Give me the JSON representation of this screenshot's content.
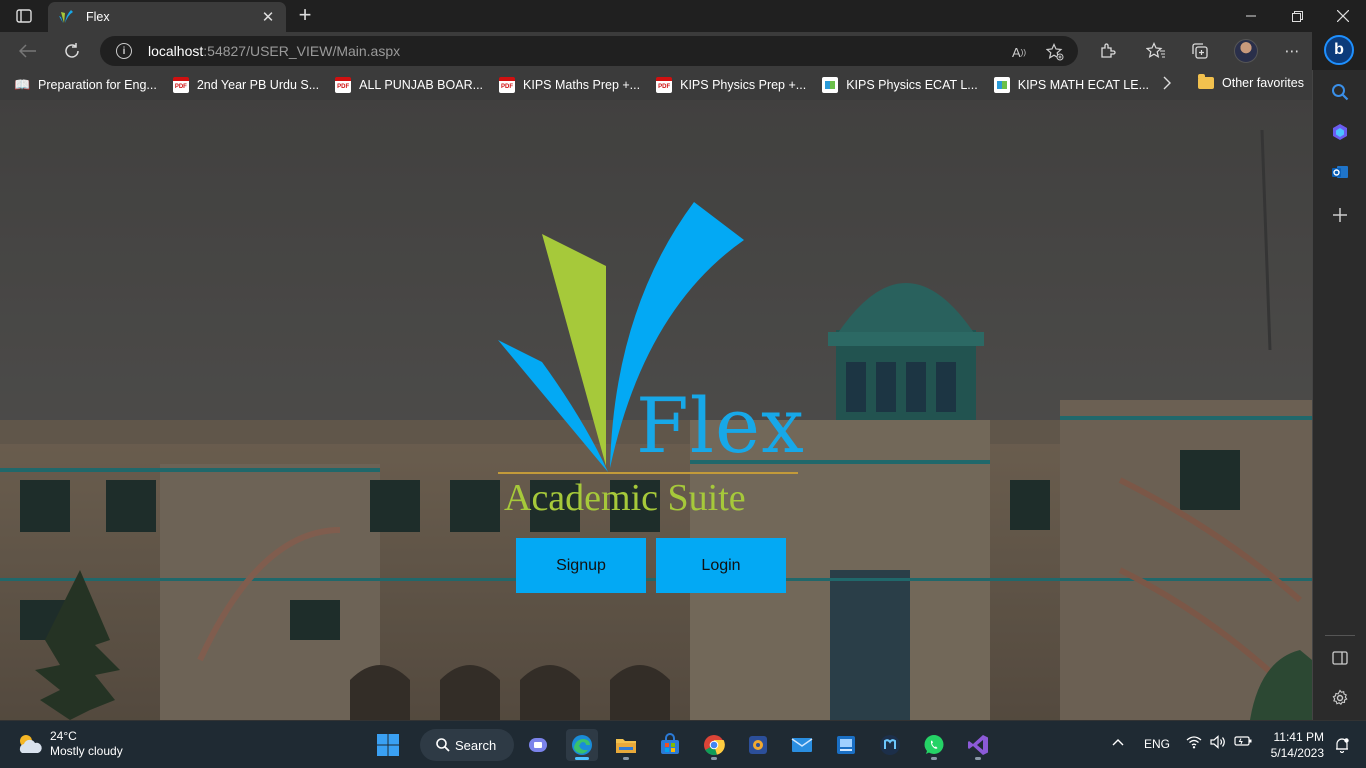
{
  "browser": {
    "tab_title": "Flex",
    "url_host": "localhost",
    "url_rest": ":54827/USER_VIEW/Main.aspx"
  },
  "favorites": {
    "items": [
      {
        "label": "Preparation for Eng...",
        "icon": "book-icon"
      },
      {
        "label": "2nd Year PB Urdu S...",
        "icon": "pdf-icon"
      },
      {
        "label": "ALL PUNJAB BOAR...",
        "icon": "pdf-icon"
      },
      {
        "label": "KIPS Maths Prep +...",
        "icon": "pdf-icon"
      },
      {
        "label": "KIPS Physics Prep +...",
        "icon": "pdf-icon"
      },
      {
        "label": "KIPS Physics ECAT L...",
        "icon": "kips-icon"
      },
      {
        "label": "KIPS MATH ECAT LE...",
        "icon": "kips-icon"
      }
    ],
    "other_label": "Other favorites"
  },
  "page": {
    "brand_word": "Flex",
    "brand_sub": "Academic Suite",
    "signup_label": "Signup",
    "login_label": "Login",
    "colors": {
      "brand_blue": "#17a8e8",
      "brand_green": "#a6c93a",
      "button_blue": "#03a9f4"
    }
  },
  "taskbar": {
    "weather_temp": "24°C",
    "weather_desc": "Mostly cloudy",
    "search_label": "Search",
    "lang": "ENG",
    "time": "11:41 PM",
    "date": "5/14/2023"
  }
}
